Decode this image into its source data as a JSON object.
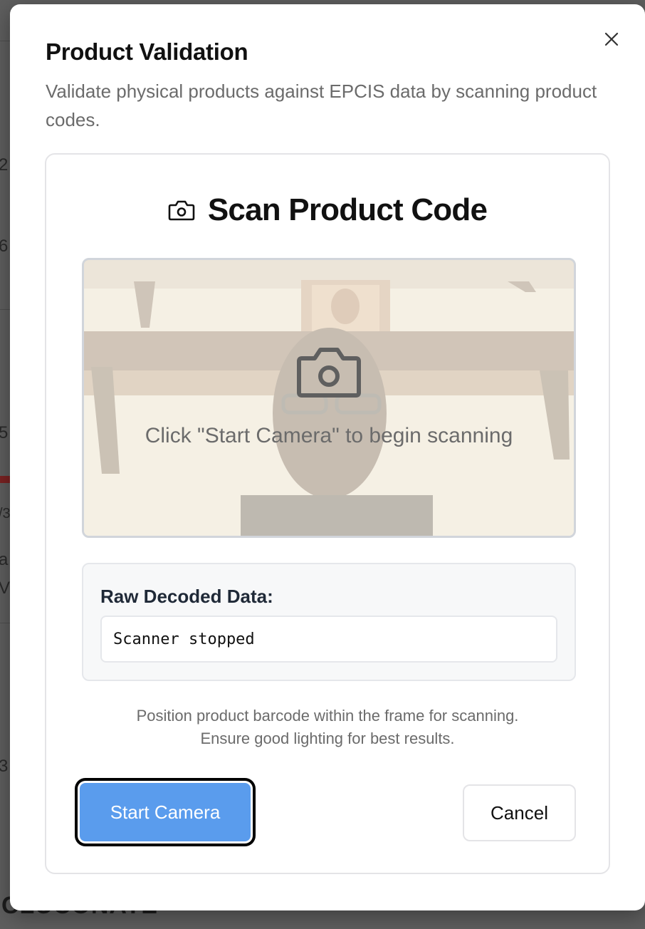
{
  "background": {
    "fragments": [
      "2",
      "6",
      "5",
      "/3",
      "a",
      "V",
      "3"
    ],
    "bottom_text": "CLUCONATE"
  },
  "dialog": {
    "title": "Product Validation",
    "description": "Validate physical products against EPCIS data by scanning product codes.",
    "close_icon": "close-icon"
  },
  "scanner": {
    "header_icon": "camera-icon",
    "title": "Scan Product Code",
    "viewport_icon": "camera-icon",
    "placeholder_text": "Click \"Start Camera\" to begin scanning"
  },
  "raw": {
    "label": "Raw Decoded Data:",
    "value": "Scanner stopped"
  },
  "hint": {
    "line1": "Position product barcode within the frame for scanning.",
    "line2": "Ensure good lighting for best results."
  },
  "actions": {
    "start_label": "Start Camera",
    "cancel_label": "Cancel"
  },
  "colors": {
    "primary_button": "#5a9ced",
    "overlay_dim": "#6f6f6f"
  }
}
